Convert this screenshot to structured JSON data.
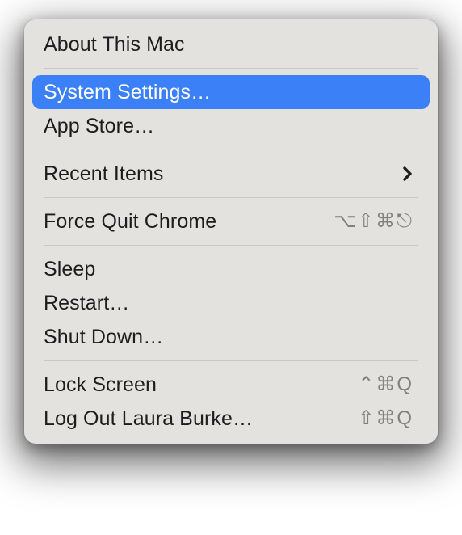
{
  "menu": {
    "items": [
      {
        "label": "About This Mac",
        "highlighted": false
      },
      {
        "separator": true
      },
      {
        "label": "System Settings…",
        "highlighted": true
      },
      {
        "label": "App Store…",
        "highlighted": false
      },
      {
        "separator": true
      },
      {
        "label": "Recent Items",
        "highlighted": false,
        "submenu": true
      },
      {
        "separator": true
      },
      {
        "label": "Force Quit Chrome",
        "highlighted": false,
        "shortcut": "⌥⇧⌘⎋"
      },
      {
        "separator": true
      },
      {
        "label": "Sleep",
        "highlighted": false
      },
      {
        "label": "Restart…",
        "highlighted": false
      },
      {
        "label": "Shut Down…",
        "highlighted": false
      },
      {
        "separator": true
      },
      {
        "label": "Lock Screen",
        "highlighted": false,
        "shortcut": "⌃⌘Q"
      },
      {
        "label": "Log Out Laura Burke…",
        "highlighted": false,
        "shortcut": "⇧⌘Q"
      }
    ]
  }
}
